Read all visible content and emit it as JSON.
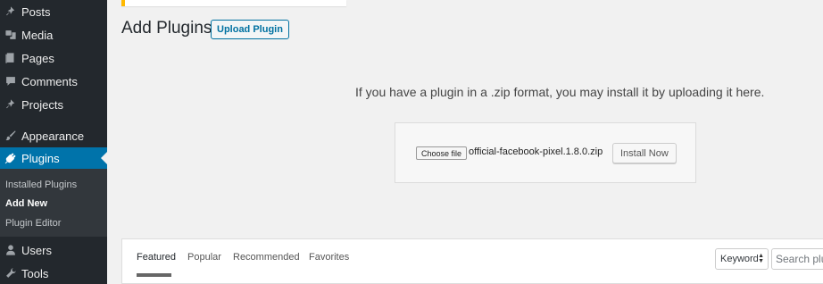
{
  "sidebar": {
    "items": [
      {
        "label": "Posts",
        "icon": "pin-icon"
      },
      {
        "label": "Media",
        "icon": "media-icon"
      },
      {
        "label": "Pages",
        "icon": "pages-icon"
      },
      {
        "label": "Comments",
        "icon": "comment-icon"
      },
      {
        "label": "Projects",
        "icon": "pin-icon"
      },
      {
        "label": "Appearance",
        "icon": "brush-icon"
      },
      {
        "label": "Plugins",
        "icon": "plug-icon",
        "current": true
      },
      {
        "label": "Users",
        "icon": "user-icon"
      },
      {
        "label": "Tools",
        "icon": "wrench-icon"
      }
    ],
    "submenu": [
      {
        "label": "Installed Plugins"
      },
      {
        "label": "Add New",
        "current": true
      },
      {
        "label": "Plugin Editor"
      }
    ]
  },
  "header": {
    "title": "Add Plugins",
    "upload_label": "Upload Plugin"
  },
  "upload": {
    "help": "If you have a plugin in a .zip format, you may install it by uploading it here.",
    "choose_label": "Choose file",
    "file_name": "official-facebook-pixel.1.8.0.zip",
    "install_label": "Install Now"
  },
  "filter": {
    "tabs": [
      {
        "label": "Featured",
        "current": true
      },
      {
        "label": "Popular"
      },
      {
        "label": "Recommended"
      },
      {
        "label": "Favorites"
      }
    ],
    "search_type": "Keyword",
    "search_placeholder": "Search plugins..."
  },
  "colors": {
    "sidebar_bg": "#23282d",
    "submenu_bg": "#32373c",
    "accent": "#0073aa",
    "notice_border": "#ffb900",
    "page_bg": "#f1f1f1"
  }
}
